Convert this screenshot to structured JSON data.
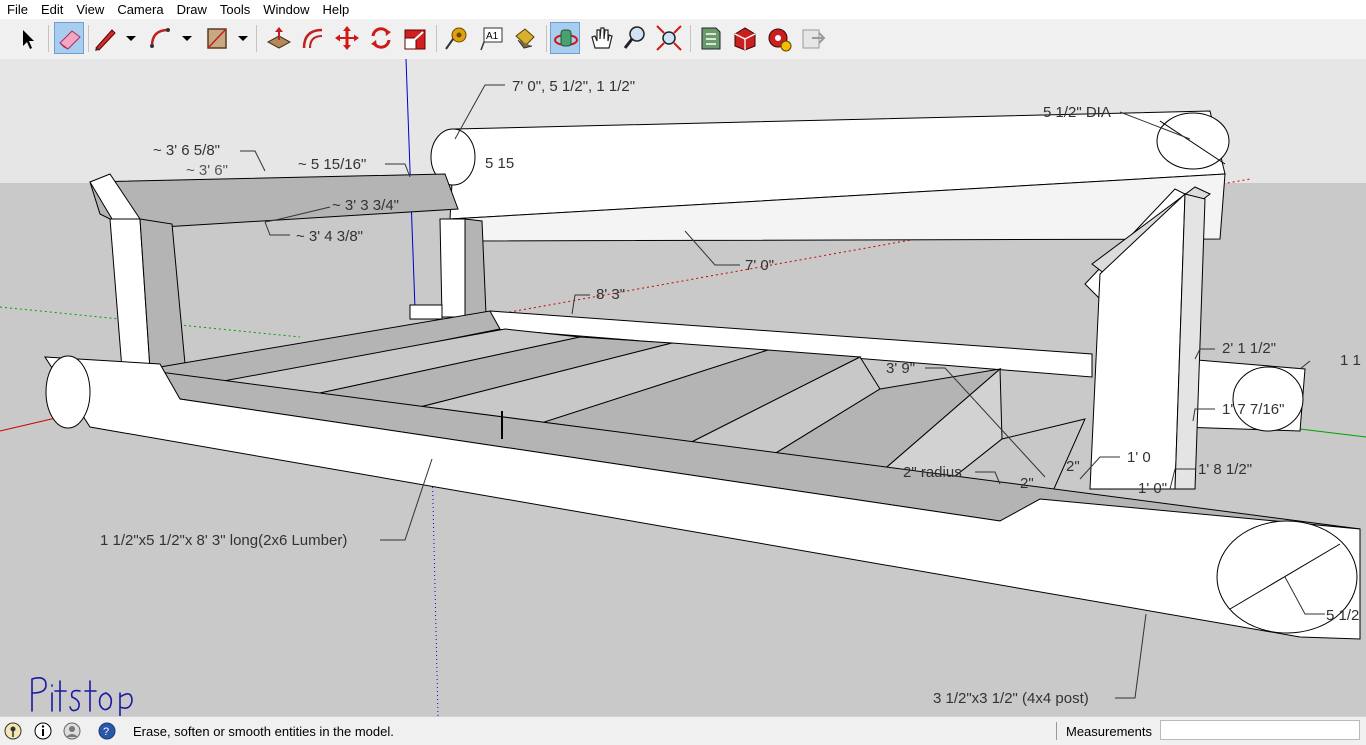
{
  "menu": [
    "File",
    "Edit",
    "View",
    "Camera",
    "Draw",
    "Tools",
    "Window",
    "Help"
  ],
  "toolbar": {
    "tools": [
      {
        "icon": "select-arrow-icon",
        "active": false
      },
      {
        "icon": "eraser-icon",
        "active": true
      },
      {
        "icon": "pencil-line-icon",
        "active": false
      },
      {
        "icon": "arc-icon",
        "active": false
      },
      {
        "icon": "rectangle-icon",
        "active": false
      },
      {
        "icon": "push-pull-icon",
        "active": false
      },
      {
        "icon": "offset-icon",
        "active": false
      },
      {
        "icon": "move-icon",
        "active": false
      },
      {
        "icon": "rotate-icon",
        "active": false
      },
      {
        "icon": "scale-icon",
        "active": false
      },
      {
        "icon": "tape-measure-icon",
        "active": false
      },
      {
        "icon": "text-icon",
        "active": false
      },
      {
        "icon": "paint-bucket-icon",
        "active": false
      },
      {
        "icon": "orbit-icon",
        "active": true
      },
      {
        "icon": "pan-hand-icon",
        "active": false
      },
      {
        "icon": "zoom-icon",
        "active": false
      },
      {
        "icon": "zoom-extents-icon",
        "active": false
      },
      {
        "icon": "warehouse-icon",
        "active": false
      },
      {
        "icon": "extension-warehouse-icon",
        "active": false
      },
      {
        "icon": "extension-manager-icon",
        "active": false
      },
      {
        "icon": "layout-send-icon",
        "active": false
      }
    ],
    "text_icon_glyph": "A1"
  },
  "dimensions": [
    {
      "id": "dim-overall-size",
      "text": "7' 0\", 5 1/2\", 1 1/2\""
    },
    {
      "id": "dim-dia-top",
      "text": "5 1/2\" DIA"
    },
    {
      "id": "dim-back-left-a",
      "text": "~ 3' 6 5/8\""
    },
    {
      "id": "dim-back-left-b",
      "text": "~ 3' 6\""
    },
    {
      "id": "dim-back-depth",
      "text": "~ 5 15/16\""
    },
    {
      "id": "dim-back-partial",
      "text": "5 15"
    },
    {
      "id": "dim-arm-a",
      "text": "~ 3' 3 3/4\""
    },
    {
      "id": "dim-arm-b",
      "text": "~ 3' 4 3/8\""
    },
    {
      "id": "dim-back-length",
      "text": "7' 0\""
    },
    {
      "id": "dim-frame-length",
      "text": "8' 3\""
    },
    {
      "id": "dim-side-height",
      "text": "2' 1 1/2\""
    },
    {
      "id": "dim-right-edge",
      "text": "1 1"
    },
    {
      "id": "dim-side-post",
      "text": "1' 7 7/16\""
    },
    {
      "id": "dim-seat-depth",
      "text": "3' 9\""
    },
    {
      "id": "dim-one-foot-a",
      "text": "1' 0"
    },
    {
      "id": "dim-one-foot-b",
      "text": "1' 0\""
    },
    {
      "id": "dim-post-height",
      "text": "1' 8 1/2\""
    },
    {
      "id": "dim-radius",
      "text": "2\" radius"
    },
    {
      "id": "dim-two-a",
      "text": "2\""
    },
    {
      "id": "dim-two-b",
      "text": "2\""
    },
    {
      "id": "dim-front-dia",
      "text": "5 1/2"
    },
    {
      "id": "label-lumber",
      "text": "1 1/2\"x5 1/2\"x 8' 3\" long(2x6 Lumber)"
    },
    {
      "id": "label-post",
      "text": "3 1/2\"x3 1/2\" (4x4 post)"
    }
  ],
  "signature": "Pitstop",
  "status": {
    "text": "Erase, soften or smooth entities in the model.",
    "measurements_label": "Measurements",
    "measurements_value": ""
  },
  "colors": {
    "sky": "#e6e6e6",
    "ground": "#c9c9c9",
    "face_light": "#ffffff",
    "face_shade": "#b4b4b4",
    "edge": "#000000",
    "axis_red": "#cc0000",
    "axis_green": "#00a000",
    "axis_blue": "#0000cc",
    "signature_ink": "#1a1aa0"
  }
}
